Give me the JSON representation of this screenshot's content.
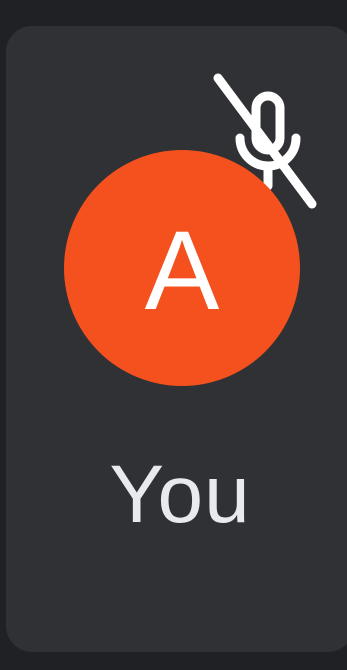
{
  "participant": {
    "avatar_letter": "A",
    "name": "You",
    "avatar_color": "#f4511e",
    "tile_color": "#303134",
    "mic_status": "muted",
    "mic_icon": "mic-off-icon"
  }
}
